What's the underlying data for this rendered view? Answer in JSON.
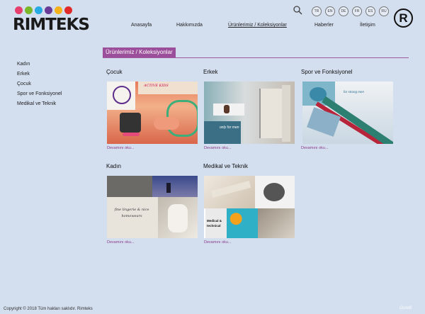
{
  "brand": {
    "name": "RIMTEKS",
    "dot_colors": [
      "#e63e6d",
      "#7ab82a",
      "#27a9e1",
      "#6a3a98",
      "#f5b21b",
      "#e02a2a"
    ]
  },
  "header": {
    "languages": [
      "TR",
      "EN",
      "DE",
      "FR",
      "ES",
      "RU"
    ],
    "nav": [
      "Anasayfa",
      "Hakkımızda",
      "Ürünlerimiz / Koleksiyonlar",
      "Haberler",
      "İletişim"
    ],
    "registered_mark": "R"
  },
  "section": {
    "title": "Ürünlerimiz / Koleksiyonlar",
    "accent": "#9b4e9a"
  },
  "sidebar": {
    "items": [
      "Kadın",
      "Erkek",
      "Çocuk",
      "Spor ve Fonksiyonel",
      "Medikal ve Teknik"
    ]
  },
  "cards": [
    {
      "title": "Çocuk",
      "thumb_text": "ACTIVE KIDS",
      "more": "Devamını oku..."
    },
    {
      "title": "Erkek",
      "thumb_text": "only for men",
      "more": "Devamını oku..."
    },
    {
      "title": "Spor ve Fonksiyonel",
      "thumb_text": "for strong men",
      "more": "Devamını oku..."
    },
    {
      "title": "Kadın",
      "thumb_text": "fine lingerie & nice homewears",
      "more": "Devamını oku..."
    },
    {
      "title": "Medikal ve Teknik",
      "thumb_text": "Medical & technical",
      "more": "Devamını oku..."
    }
  ],
  "footer": {
    "copyright": "Copyright © 2018 Tüm hakları saklıdır. Rimteks",
    "watermark": "Ücretli"
  }
}
